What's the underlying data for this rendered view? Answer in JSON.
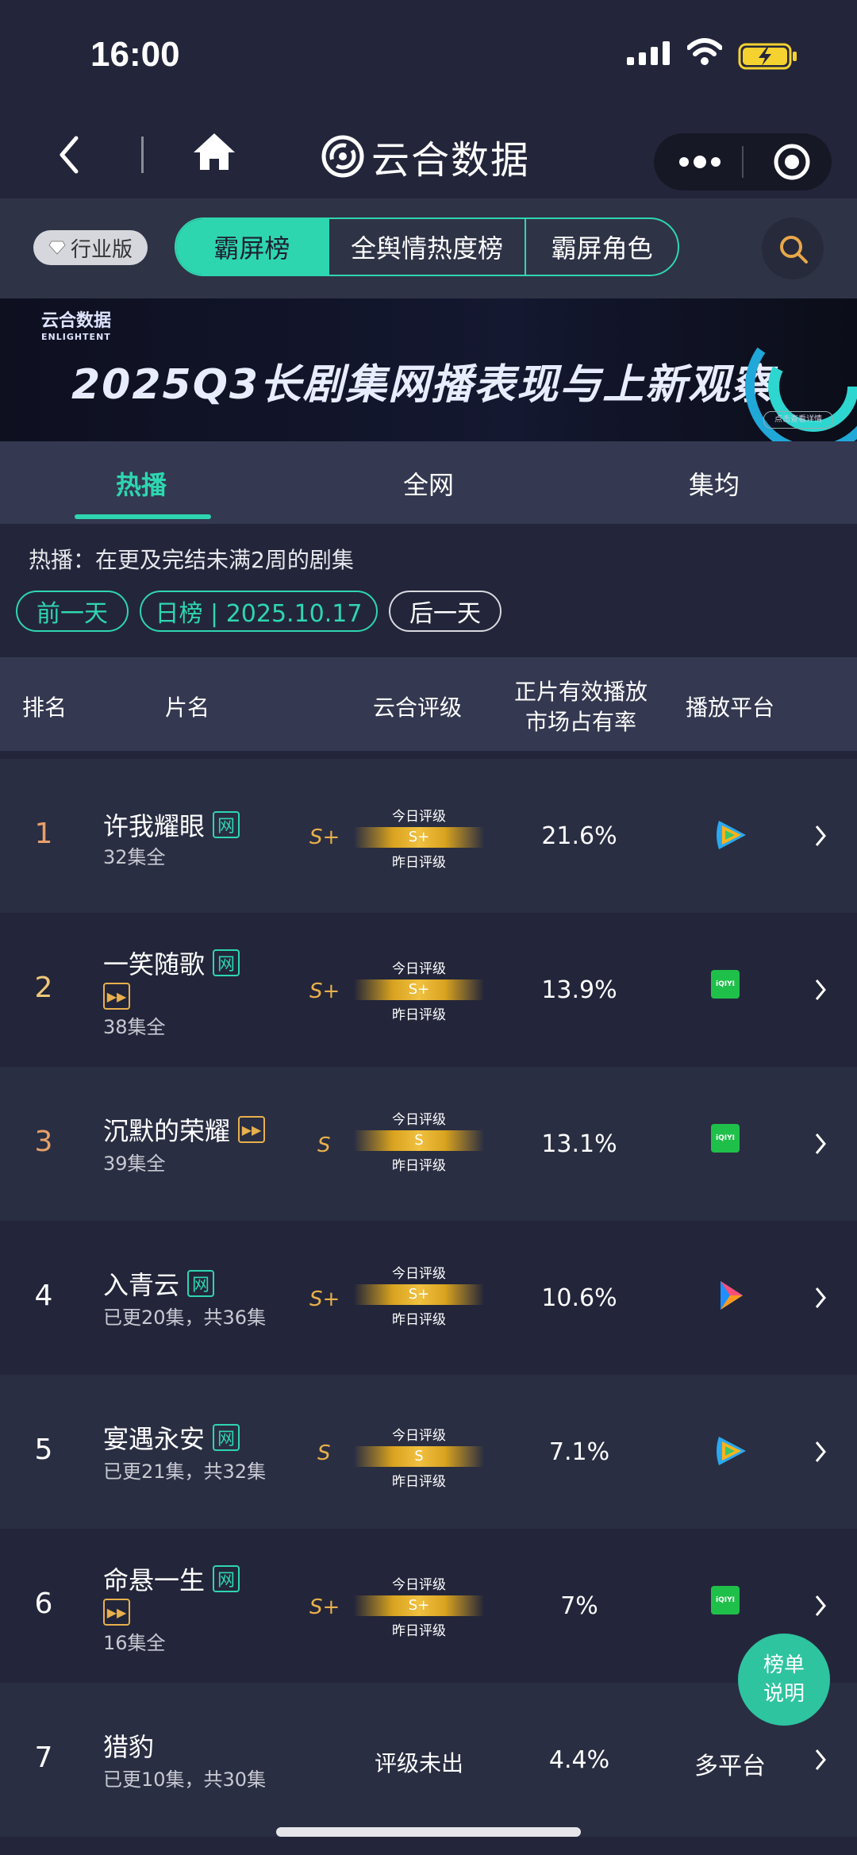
{
  "status": {
    "time": "16:00"
  },
  "nav": {
    "app_name": "云合数据"
  },
  "topbar": {
    "badge": "行业版",
    "segments": [
      "霸屏榜",
      "全舆情热度榜",
      "霸屏角色"
    ],
    "active_segment": "霸屏榜"
  },
  "banner": {
    "logo_cn": "云合数据",
    "logo_en": "ENLIGHTENT",
    "title": "2025Q3长剧集网播表现与上新观察",
    "button": "点击查看详情"
  },
  "tabs": [
    "热播",
    "全网",
    "集均"
  ],
  "active_tab": "热播",
  "note": "热播：在更及完结未满2周的剧集",
  "date_nav": {
    "prev": "前一天",
    "current": "日榜 | 2025.10.17",
    "next": "后一天"
  },
  "table": {
    "headers": {
      "rank": "排名",
      "name": "片名",
      "grade": "云合评级",
      "share_line1": "正片有效播放",
      "share_line2": "市场占有率",
      "platform": "播放平台"
    },
    "rating_labels": {
      "today": "今日评级",
      "yesterday": "昨日评级"
    },
    "rows": [
      {
        "rank": "1",
        "title": "许我耀眼",
        "tags": [
          "网"
        ],
        "episodes": "32集全",
        "grade": "S+",
        "bar": "S+",
        "share": "21.6%",
        "platform": "tencent-video"
      },
      {
        "rank": "2",
        "title": "一笑随歌",
        "tags": [
          "网",
          "ff"
        ],
        "episodes": "38集全",
        "grade": "S+",
        "bar": "S+",
        "share": "13.9%",
        "platform": "iqiyi"
      },
      {
        "rank": "3",
        "title": "沉默的荣耀",
        "tags": [
          "ff"
        ],
        "episodes": "39集全",
        "grade": "S",
        "bar": "S",
        "share": "13.1%",
        "platform": "iqiyi"
      },
      {
        "rank": "4",
        "title": "入青云",
        "tags": [
          "网"
        ],
        "episodes": "已更20集，共36集",
        "grade": "S+",
        "bar": "S+",
        "share": "10.6%",
        "platform": "youku"
      },
      {
        "rank": "5",
        "title": "宴遇永安",
        "tags": [
          "网"
        ],
        "episodes": "已更21集，共32集",
        "grade": "S",
        "bar": "S",
        "share": "7.1%",
        "platform": "tencent-video"
      },
      {
        "rank": "6",
        "title": "命悬一生",
        "tags": [
          "网",
          "ff"
        ],
        "episodes": "16集全",
        "grade": "S+",
        "bar": "S+",
        "share": "7%",
        "platform": "iqiyi"
      },
      {
        "rank": "7",
        "title": "猎豹",
        "tags": [],
        "episodes": "已更10集，共30集",
        "grade_text": "评级未出",
        "share": "4.4%",
        "platform_text": "多平台"
      }
    ]
  },
  "help_button": {
    "line1": "榜单",
    "line2": "说明"
  },
  "iqiyi_label": "iQIYI",
  "tag_wang": "网"
}
